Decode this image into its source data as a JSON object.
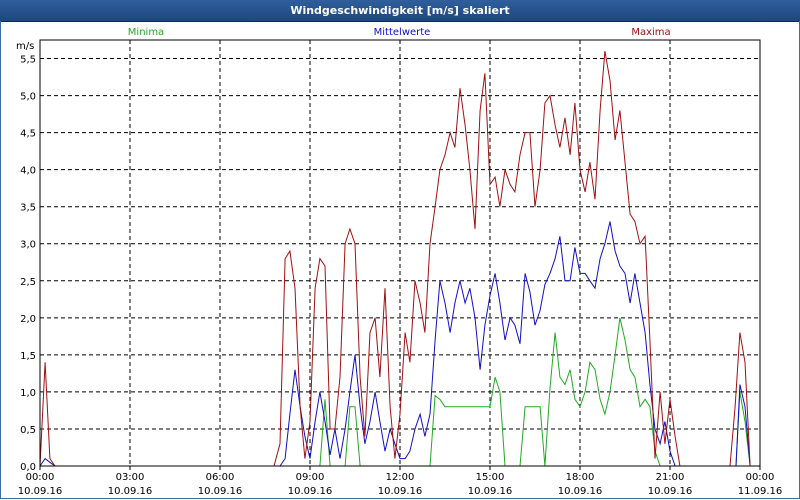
{
  "window": {
    "title": "Windgeschwindigkeit [m/s] skaliert"
  },
  "chart_data": {
    "type": "line",
    "title": "Windgeschwindigkeit [m/s] skaliert",
    "ylabel": "m/s",
    "xlabel": "",
    "ylim": [
      0,
      5.75
    ],
    "xlim": [
      0,
      24
    ],
    "grid": true,
    "legend_position": "top",
    "y_ticks": [
      "0,0",
      "0,5",
      "1,0",
      "1,5",
      "2,0",
      "2,5",
      "3,0",
      "3,5",
      "4,0",
      "4,5",
      "5,0",
      "5,5"
    ],
    "x_ticks": [
      {
        "time": "00:00",
        "date": "10.09.16"
      },
      {
        "time": "03:00",
        "date": "10.09.16"
      },
      {
        "time": "06:00",
        "date": "10.09.16"
      },
      {
        "time": "09:00",
        "date": "10.09.16"
      },
      {
        "time": "12:00",
        "date": "10.09.16"
      },
      {
        "time": "15:00",
        "date": "10.09.16"
      },
      {
        "time": "18:00",
        "date": "10.09.16"
      },
      {
        "time": "21:00",
        "date": "10.09.16"
      },
      {
        "time": "00:00",
        "date": "11.09.16"
      }
    ],
    "series": [
      {
        "name": "Minima",
        "color": "#22aa22",
        "points": [
          [
            0.0,
            0
          ],
          [
            7.8,
            0
          ],
          [
            8.0,
            0
          ],
          [
            8.5,
            0
          ],
          [
            8.7,
            0
          ],
          [
            8.83,
            0
          ],
          [
            9.0,
            0
          ],
          [
            9.17,
            0
          ],
          [
            9.33,
            0
          ],
          [
            9.5,
            0.9
          ],
          [
            9.67,
            0
          ],
          [
            9.83,
            0
          ],
          [
            10.0,
            0
          ],
          [
            10.17,
            0
          ],
          [
            10.33,
            0.8
          ],
          [
            10.5,
            0.8
          ],
          [
            10.67,
            0
          ],
          [
            10.83,
            0
          ],
          [
            11.0,
            0
          ],
          [
            11.17,
            0
          ],
          [
            11.33,
            0
          ],
          [
            11.5,
            0
          ],
          [
            11.67,
            0
          ],
          [
            11.83,
            0
          ],
          [
            12.0,
            0
          ],
          [
            12.17,
            0
          ],
          [
            12.33,
            0
          ],
          [
            12.5,
            0
          ],
          [
            12.67,
            0
          ],
          [
            12.83,
            0
          ],
          [
            13.0,
            0
          ],
          [
            13.17,
            0.95
          ],
          [
            13.33,
            0.9
          ],
          [
            13.5,
            0.8
          ],
          [
            13.67,
            0.8
          ],
          [
            13.83,
            0.8
          ],
          [
            14.0,
            0.8
          ],
          [
            14.17,
            0.8
          ],
          [
            14.33,
            0.8
          ],
          [
            14.5,
            0.8
          ],
          [
            14.67,
            0.8
          ],
          [
            14.83,
            0.8
          ],
          [
            15.0,
            0.8
          ],
          [
            15.17,
            1.2
          ],
          [
            15.33,
            1.0
          ],
          [
            15.5,
            0
          ],
          [
            15.67,
            0
          ],
          [
            15.83,
            0
          ],
          [
            16.0,
            0
          ],
          [
            16.17,
            0.8
          ],
          [
            16.33,
            0.8
          ],
          [
            16.5,
            0.8
          ],
          [
            16.67,
            0.8
          ],
          [
            16.83,
            0
          ],
          [
            17.0,
            1.05
          ],
          [
            17.17,
            1.8
          ],
          [
            17.33,
            1.2
          ],
          [
            17.5,
            1.1
          ],
          [
            17.67,
            1.3
          ],
          [
            17.83,
            0.9
          ],
          [
            18.0,
            0.8
          ],
          [
            18.17,
            1.0
          ],
          [
            18.33,
            1.4
          ],
          [
            18.5,
            1.3
          ],
          [
            18.67,
            0.9
          ],
          [
            18.83,
            0.7
          ],
          [
            19.0,
            1.0
          ],
          [
            19.17,
            1.5
          ],
          [
            19.33,
            2.0
          ],
          [
            19.5,
            1.7
          ],
          [
            19.67,
            1.3
          ],
          [
            19.83,
            1.2
          ],
          [
            20.0,
            0.8
          ],
          [
            20.17,
            0.9
          ],
          [
            20.33,
            0.8
          ],
          [
            20.5,
            0.2
          ],
          [
            20.67,
            0
          ],
          [
            20.83,
            0
          ],
          [
            21.0,
            0
          ],
          [
            21.5,
            0
          ],
          [
            22.0,
            0
          ],
          [
            23.0,
            0
          ],
          [
            23.2,
            0
          ],
          [
            23.33,
            1.0
          ],
          [
            23.5,
            0.6
          ],
          [
            23.67,
            0
          ],
          [
            24.0,
            0
          ]
        ]
      },
      {
        "name": "Mittelwerte",
        "color": "#1010c0",
        "points": [
          [
            0.0,
            0
          ],
          [
            0.17,
            0.1
          ],
          [
            0.33,
            0.05
          ],
          [
            0.5,
            0
          ],
          [
            7.8,
            0
          ],
          [
            8.0,
            0
          ],
          [
            8.17,
            0.1
          ],
          [
            8.33,
            0.7
          ],
          [
            8.5,
            1.3
          ],
          [
            8.67,
            0.8
          ],
          [
            8.83,
            0.4
          ],
          [
            9.0,
            0.1
          ],
          [
            9.17,
            0.6
          ],
          [
            9.33,
            1.0
          ],
          [
            9.5,
            0.6
          ],
          [
            9.67,
            0.15
          ],
          [
            9.83,
            0.5
          ],
          [
            10.0,
            0.1
          ],
          [
            10.17,
            0.5
          ],
          [
            10.33,
            1.0
          ],
          [
            10.5,
            1.5
          ],
          [
            10.67,
            0.8
          ],
          [
            10.83,
            0.3
          ],
          [
            11.0,
            0.6
          ],
          [
            11.17,
            1.0
          ],
          [
            11.33,
            0.6
          ],
          [
            11.5,
            0.2
          ],
          [
            11.67,
            0.5
          ],
          [
            11.83,
            0.3
          ],
          [
            12.0,
            0.1
          ],
          [
            12.17,
            0.1
          ],
          [
            12.33,
            0.2
          ],
          [
            12.5,
            0.5
          ],
          [
            12.67,
            0.7
          ],
          [
            12.83,
            0.4
          ],
          [
            13.0,
            0.7
          ],
          [
            13.17,
            1.7
          ],
          [
            13.33,
            2.5
          ],
          [
            13.5,
            2.2
          ],
          [
            13.67,
            1.8
          ],
          [
            13.83,
            2.2
          ],
          [
            14.0,
            2.5
          ],
          [
            14.17,
            2.2
          ],
          [
            14.33,
            2.4
          ],
          [
            14.5,
            2.0
          ],
          [
            14.67,
            1.3
          ],
          [
            14.83,
            1.9
          ],
          [
            15.0,
            2.3
          ],
          [
            15.17,
            2.6
          ],
          [
            15.33,
            2.2
          ],
          [
            15.5,
            1.7
          ],
          [
            15.67,
            2.0
          ],
          [
            15.83,
            1.9
          ],
          [
            16.0,
            1.65
          ],
          [
            16.17,
            2.6
          ],
          [
            16.33,
            2.35
          ],
          [
            16.5,
            1.9
          ],
          [
            16.67,
            2.1
          ],
          [
            16.83,
            2.45
          ],
          [
            17.0,
            2.6
          ],
          [
            17.17,
            2.8
          ],
          [
            17.33,
            3.1
          ],
          [
            17.5,
            2.5
          ],
          [
            17.67,
            2.5
          ],
          [
            17.83,
            2.95
          ],
          [
            18.0,
            2.6
          ],
          [
            18.17,
            2.6
          ],
          [
            18.33,
            2.5
          ],
          [
            18.5,
            2.4
          ],
          [
            18.67,
            2.8
          ],
          [
            18.83,
            3.0
          ],
          [
            19.0,
            3.3
          ],
          [
            19.17,
            2.9
          ],
          [
            19.33,
            2.7
          ],
          [
            19.5,
            2.6
          ],
          [
            19.67,
            2.2
          ],
          [
            19.83,
            2.6
          ],
          [
            20.0,
            2.2
          ],
          [
            20.17,
            1.8
          ],
          [
            20.33,
            1.1
          ],
          [
            20.5,
            0.5
          ],
          [
            20.67,
            0.3
          ],
          [
            20.83,
            0.6
          ],
          [
            21.0,
            0.2
          ],
          [
            21.17,
            0
          ],
          [
            23.0,
            0
          ],
          [
            23.2,
            0
          ],
          [
            23.33,
            1.1
          ],
          [
            23.5,
            0.8
          ],
          [
            23.67,
            0
          ],
          [
            24.0,
            0
          ]
        ]
      },
      {
        "name": "Maxima",
        "color": "#a01010",
        "points": [
          [
            0.0,
            0
          ],
          [
            0.17,
            1.4
          ],
          [
            0.33,
            0.1
          ],
          [
            0.5,
            0
          ],
          [
            7.8,
            0
          ],
          [
            8.0,
            0.3
          ],
          [
            8.17,
            2.8
          ],
          [
            8.33,
            2.9
          ],
          [
            8.5,
            2.4
          ],
          [
            8.67,
            0.8
          ],
          [
            8.83,
            0.1
          ],
          [
            9.0,
            0.6
          ],
          [
            9.17,
            2.4
          ],
          [
            9.33,
            2.8
          ],
          [
            9.5,
            2.7
          ],
          [
            9.67,
            0.5
          ],
          [
            9.83,
            0.5
          ],
          [
            10.0,
            1.2
          ],
          [
            10.17,
            3.0
          ],
          [
            10.33,
            3.2
          ],
          [
            10.5,
            3.0
          ],
          [
            10.67,
            1.2
          ],
          [
            10.83,
            0.4
          ],
          [
            11.0,
            1.8
          ],
          [
            11.17,
            2.0
          ],
          [
            11.33,
            1.2
          ],
          [
            11.5,
            2.4
          ],
          [
            11.67,
            0.8
          ],
          [
            11.83,
            0.1
          ],
          [
            12.0,
            0.7
          ],
          [
            12.17,
            1.8
          ],
          [
            12.33,
            1.4
          ],
          [
            12.5,
            2.5
          ],
          [
            12.67,
            2.2
          ],
          [
            12.83,
            1.8
          ],
          [
            13.0,
            3.0
          ],
          [
            13.17,
            3.5
          ],
          [
            13.33,
            4.0
          ],
          [
            13.5,
            4.2
          ],
          [
            13.67,
            4.5
          ],
          [
            13.83,
            4.3
          ],
          [
            14.0,
            5.1
          ],
          [
            14.17,
            4.6
          ],
          [
            14.33,
            4.0
          ],
          [
            14.5,
            3.2
          ],
          [
            14.67,
            4.8
          ],
          [
            14.83,
            5.3
          ],
          [
            15.0,
            3.8
          ],
          [
            15.17,
            3.9
          ],
          [
            15.33,
            3.5
          ],
          [
            15.5,
            4.0
          ],
          [
            15.67,
            3.8
          ],
          [
            15.83,
            3.7
          ],
          [
            16.0,
            4.2
          ],
          [
            16.17,
            4.5
          ],
          [
            16.33,
            4.5
          ],
          [
            16.5,
            3.5
          ],
          [
            16.67,
            4.0
          ],
          [
            16.83,
            4.9
          ],
          [
            17.0,
            5.0
          ],
          [
            17.17,
            4.6
          ],
          [
            17.33,
            4.3
          ],
          [
            17.5,
            4.7
          ],
          [
            17.67,
            4.2
          ],
          [
            17.83,
            4.9
          ],
          [
            18.0,
            4.0
          ],
          [
            18.17,
            3.7
          ],
          [
            18.33,
            4.1
          ],
          [
            18.5,
            3.6
          ],
          [
            18.67,
            4.8
          ],
          [
            18.83,
            5.6
          ],
          [
            19.0,
            5.2
          ],
          [
            19.17,
            4.4
          ],
          [
            19.33,
            4.8
          ],
          [
            19.5,
            4.1
          ],
          [
            19.67,
            3.4
          ],
          [
            19.83,
            3.3
          ],
          [
            20.0,
            3.0
          ],
          [
            20.17,
            3.1
          ],
          [
            20.33,
            1.7
          ],
          [
            20.5,
            0.1
          ],
          [
            20.67,
            1.0
          ],
          [
            20.83,
            0.3
          ],
          [
            21.0,
            0.9
          ],
          [
            21.17,
            0.4
          ],
          [
            21.33,
            0
          ],
          [
            23.0,
            0
          ],
          [
            23.17,
            0.8
          ],
          [
            23.33,
            1.8
          ],
          [
            23.5,
            1.4
          ],
          [
            23.67,
            0
          ],
          [
            24.0,
            0
          ]
        ]
      }
    ]
  }
}
